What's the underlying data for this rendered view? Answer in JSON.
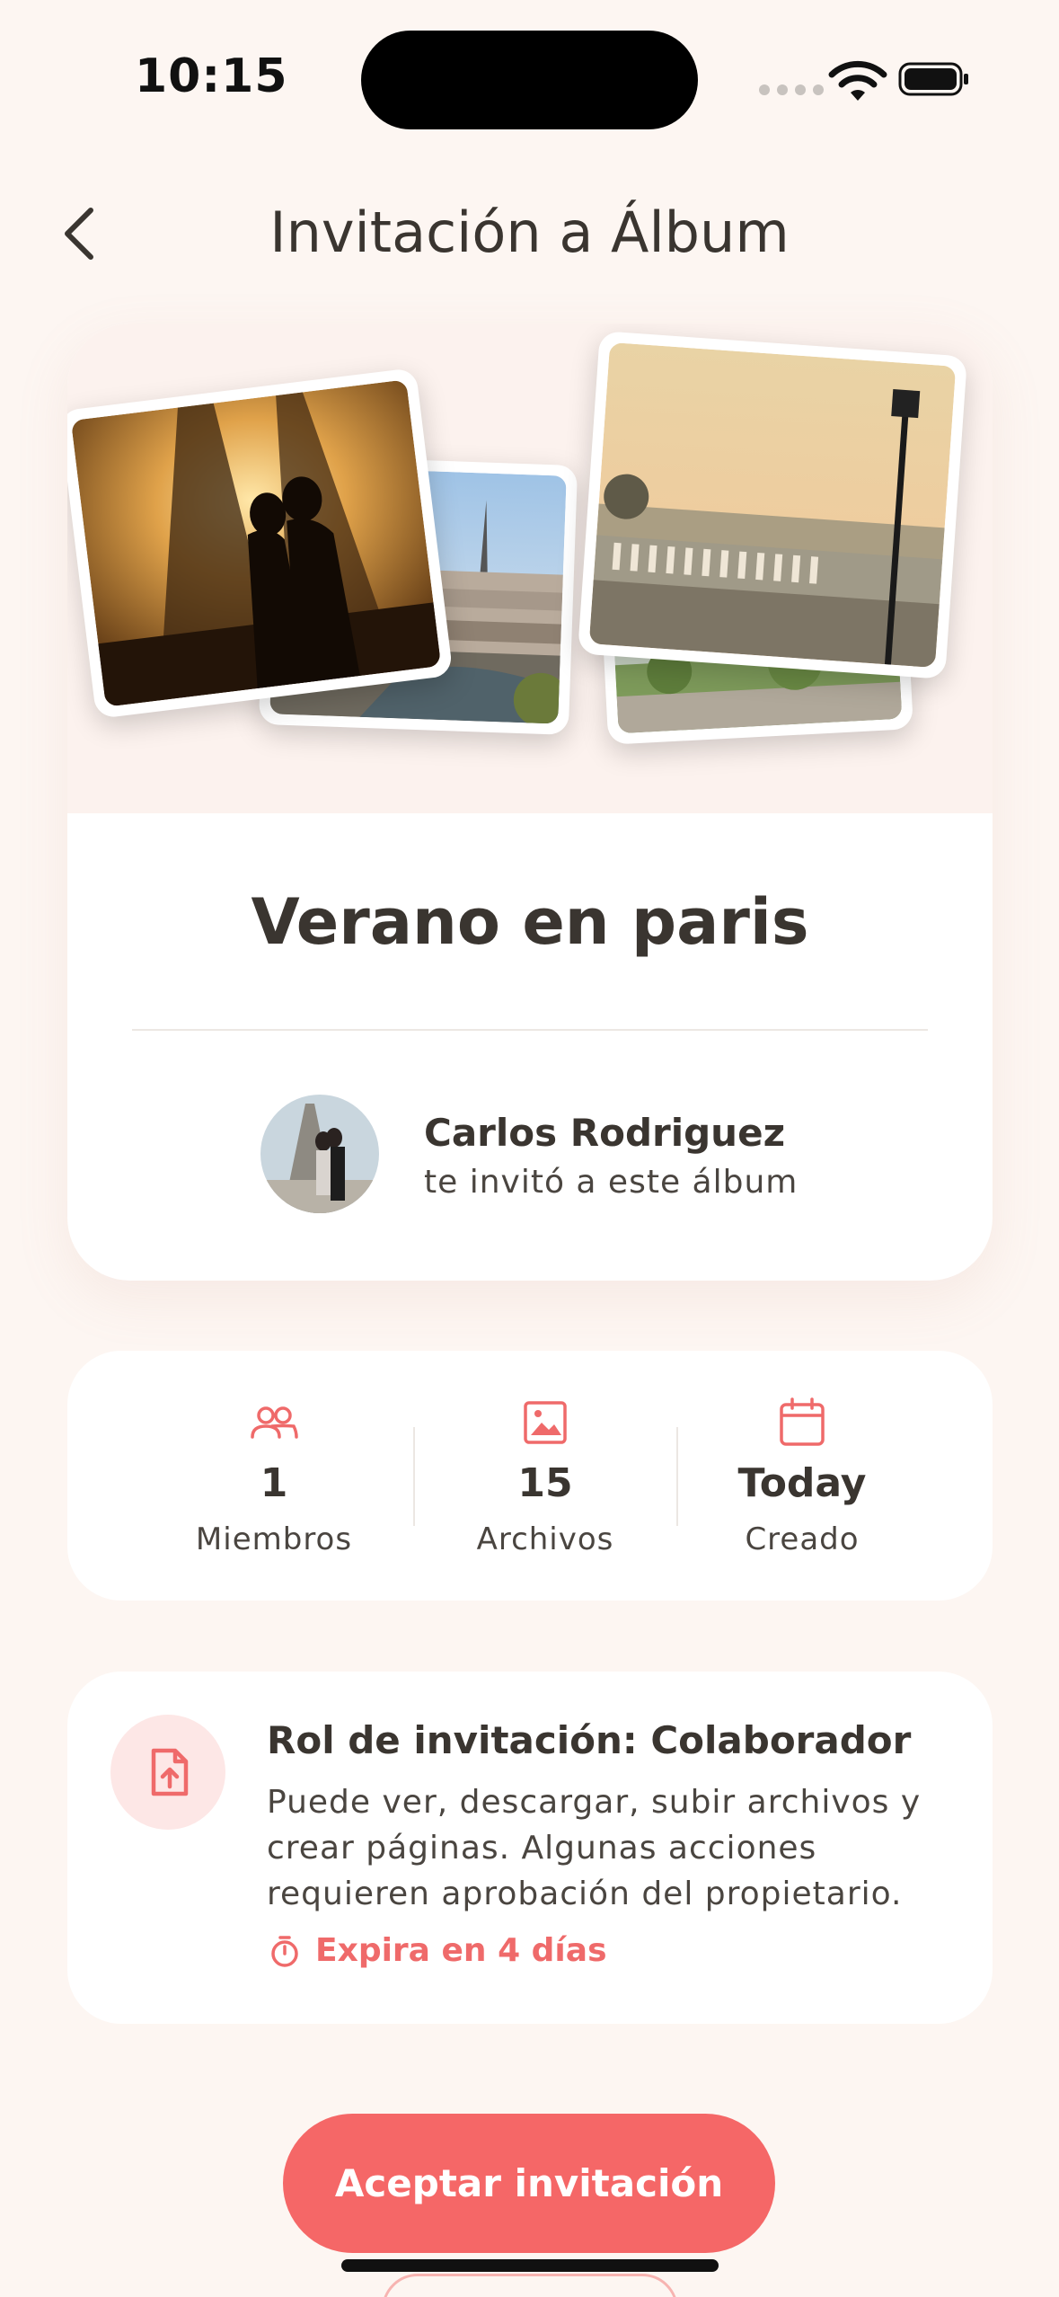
{
  "status_bar": {
    "time": "10:15"
  },
  "header": {
    "title": "Invitación a Álbum"
  },
  "album": {
    "name": "Verano en paris",
    "inviter_name": "Carlos Rodriguez",
    "inviter_subtitle": "te invitó a este álbum"
  },
  "stats": [
    {
      "icon": "members-icon",
      "value": "1",
      "label": "Miembros"
    },
    {
      "icon": "image-icon",
      "value": "15",
      "label": "Archivos"
    },
    {
      "icon": "calendar-icon",
      "value": "Today",
      "label": "Creado"
    }
  ],
  "role": {
    "title": "Rol de invitación: Colaborador",
    "description": "Puede ver, descargar, subir archivos y crear páginas. Algunas acciones requieren aprobación del propietario.",
    "expiry": "Expira en 4 días"
  },
  "actions": {
    "accept_label": "Aceptar invitación"
  },
  "colors": {
    "accent": "#f56767",
    "background": "#fdf6f2",
    "icon_tint": "#ef6a6a"
  }
}
